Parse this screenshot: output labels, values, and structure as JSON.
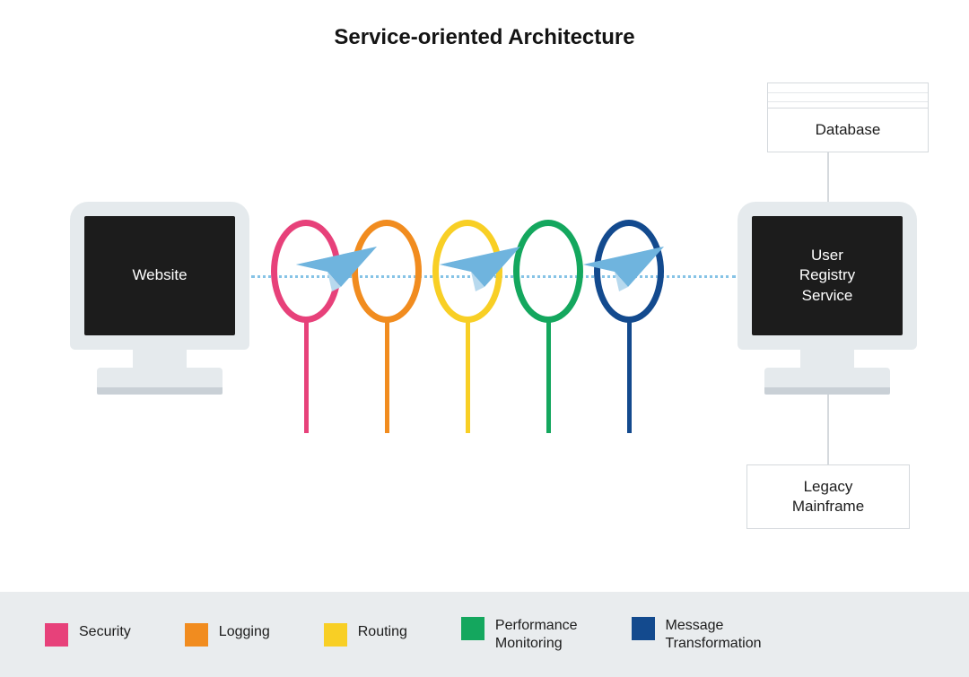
{
  "title": "Service-oriented Architecture",
  "nodes": {
    "website": "Website",
    "user_registry_service": "User\nRegistry\nService",
    "database": "Database",
    "legacy_mainframe": "Legacy\nMainframe"
  },
  "hoops": [
    {
      "id": "security",
      "label": "Security",
      "color": "#e7417a"
    },
    {
      "id": "logging",
      "label": "Logging",
      "color": "#f18c1f"
    },
    {
      "id": "routing",
      "label": "Routing",
      "color": "#f8cf25"
    },
    {
      "id": "performance-monitoring",
      "label": "Performance\nMonitoring",
      "color": "#14a75e"
    },
    {
      "id": "message-transformation",
      "label": "Message\nTransformation",
      "color": "#134a8e"
    }
  ],
  "colors": {
    "plane_light": "#b7d9ee",
    "plane_dark": "#6fb4de",
    "dotted": "#86c3e6",
    "monitor": "#e5eaed",
    "screen": "#1c1c1c",
    "legend_bg": "#e9ecee",
    "box_border": "#d5d9dd"
  }
}
